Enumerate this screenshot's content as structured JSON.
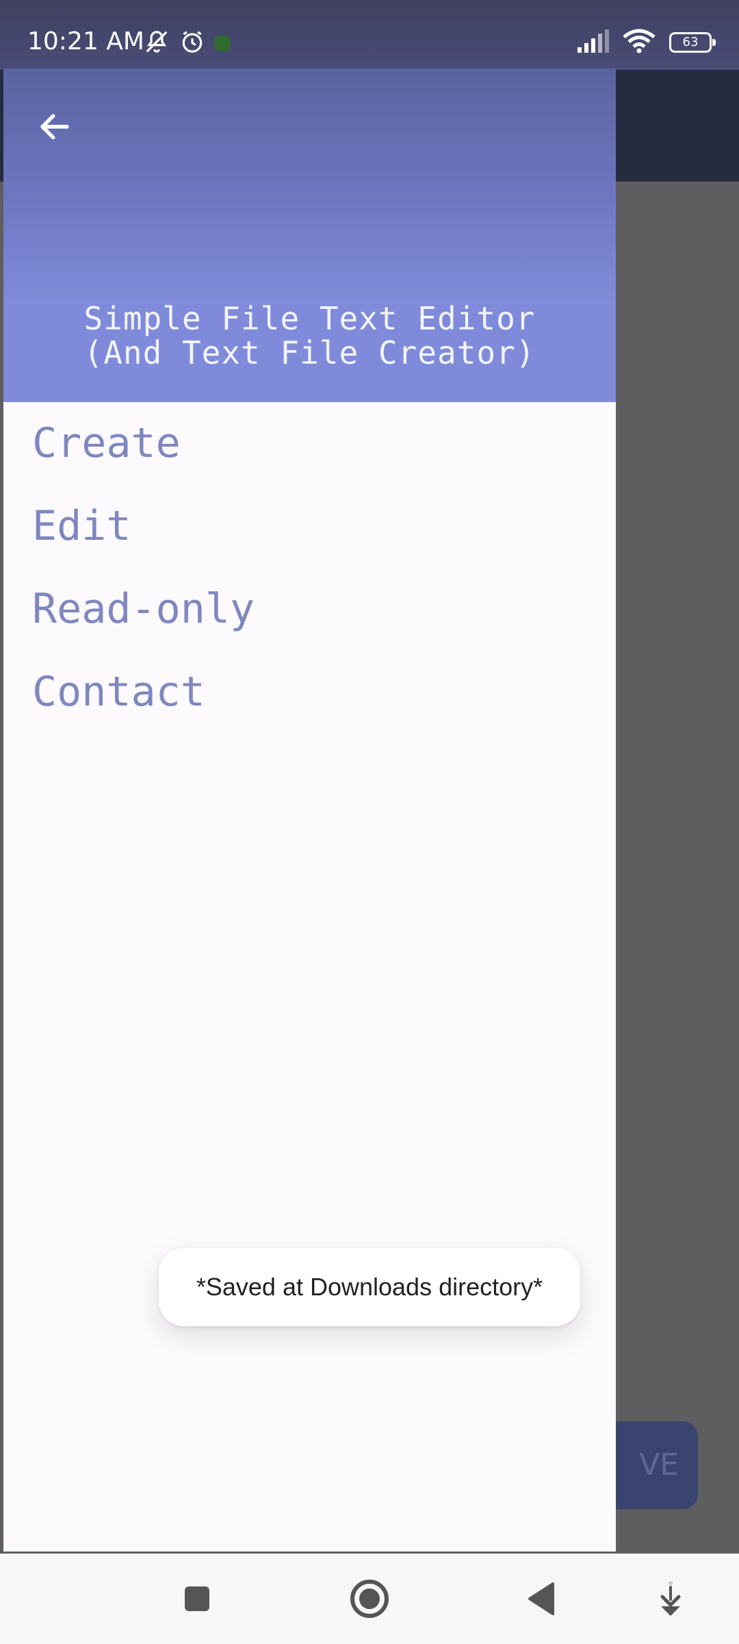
{
  "status_bar": {
    "time": "10:21 AM",
    "battery_level": "63",
    "icons": [
      "mute-icon",
      "alarm-icon",
      "notification-icon",
      "signal-icon",
      "wifi-icon",
      "battery-icon"
    ]
  },
  "drawer": {
    "title_line1": "Simple File Text Editor",
    "title_line2": "(And Text File Creator)",
    "items": [
      {
        "label": "Create"
      },
      {
        "label": "Edit"
      },
      {
        "label": "Read-only"
      },
      {
        "label": "Contact"
      }
    ]
  },
  "background": {
    "save_button_label": "VE"
  },
  "toast": {
    "message": "*Saved at Downloads directory*"
  },
  "nav_bar": {
    "buttons": [
      "recents-icon",
      "home-icon",
      "back-icon",
      "assist-icon"
    ]
  },
  "colors": {
    "drawer_header": "#7f8bda",
    "menu_text": "#7f87c0",
    "scrim": "#5e5e60"
  }
}
